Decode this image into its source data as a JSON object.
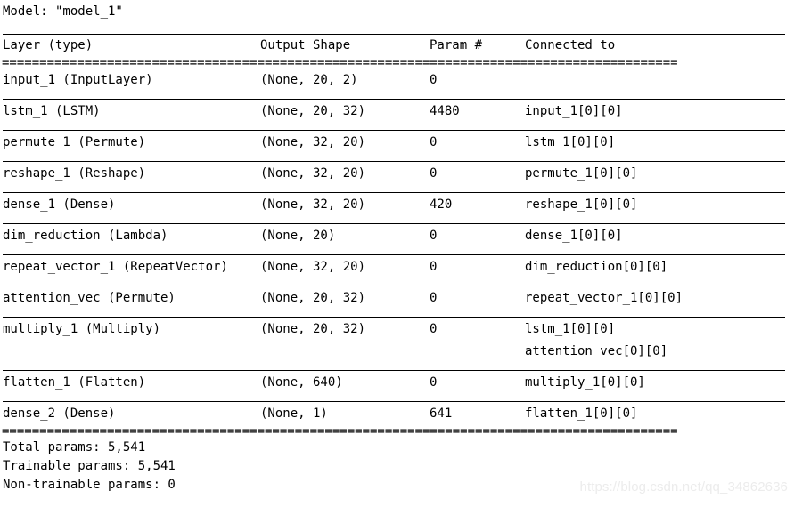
{
  "model": {
    "title_line": "Model: \"model_1\""
  },
  "table": {
    "headers": {
      "layer": "Layer (type)",
      "output_shape": "Output Shape",
      "param": "Param #",
      "connected_to": "Connected to"
    },
    "header_rule": "==========================================================================================",
    "footer_rule": "==========================================================================================",
    "rows": [
      {
        "layer": "input_1 (InputLayer)",
        "output_shape": "(None, 20, 2)",
        "param": "0",
        "connected_to": [
          ""
        ]
      },
      {
        "layer": "lstm_1 (LSTM)",
        "output_shape": "(None, 20, 32)",
        "param": "4480",
        "connected_to": [
          "input_1[0][0]"
        ]
      },
      {
        "layer": "permute_1 (Permute)",
        "output_shape": "(None, 32, 20)",
        "param": "0",
        "connected_to": [
          "lstm_1[0][0]"
        ]
      },
      {
        "layer": "reshape_1 (Reshape)",
        "output_shape": "(None, 32, 20)",
        "param": "0",
        "connected_to": [
          "permute_1[0][0]"
        ]
      },
      {
        "layer": "dense_1 (Dense)",
        "output_shape": "(None, 32, 20)",
        "param": "420",
        "connected_to": [
          "reshape_1[0][0]"
        ]
      },
      {
        "layer": "dim_reduction (Lambda)",
        "output_shape": "(None, 20)",
        "param": "0",
        "connected_to": [
          "dense_1[0][0]"
        ]
      },
      {
        "layer": "repeat_vector_1 (RepeatVector)",
        "output_shape": "(None, 32, 20)",
        "param": "0",
        "connected_to": [
          "dim_reduction[0][0]"
        ]
      },
      {
        "layer": "attention_vec (Permute)",
        "output_shape": "(None, 20, 32)",
        "param": "0",
        "connected_to": [
          "repeat_vector_1[0][0]"
        ]
      },
      {
        "layer": "multiply_1 (Multiply)",
        "output_shape": "(None, 20, 32)",
        "param": "0",
        "connected_to": [
          "lstm_1[0][0]",
          "attention_vec[0][0]"
        ]
      },
      {
        "layer": "flatten_1 (Flatten)",
        "output_shape": "(None, 640)",
        "param": "0",
        "connected_to": [
          "multiply_1[0][0]"
        ]
      },
      {
        "layer": "dense_2 (Dense)",
        "output_shape": "(None, 1)",
        "param": "641",
        "connected_to": [
          "flatten_1[0][0]"
        ]
      }
    ]
  },
  "totals": {
    "total_params": "Total params: 5,541",
    "trainable_params": "Trainable params: 5,541",
    "non_trainable_params": "Non-trainable params: 0"
  },
  "watermark": {
    "text": "https://blog.csdn.net/qq_34862636",
    "color": "#ececec"
  }
}
